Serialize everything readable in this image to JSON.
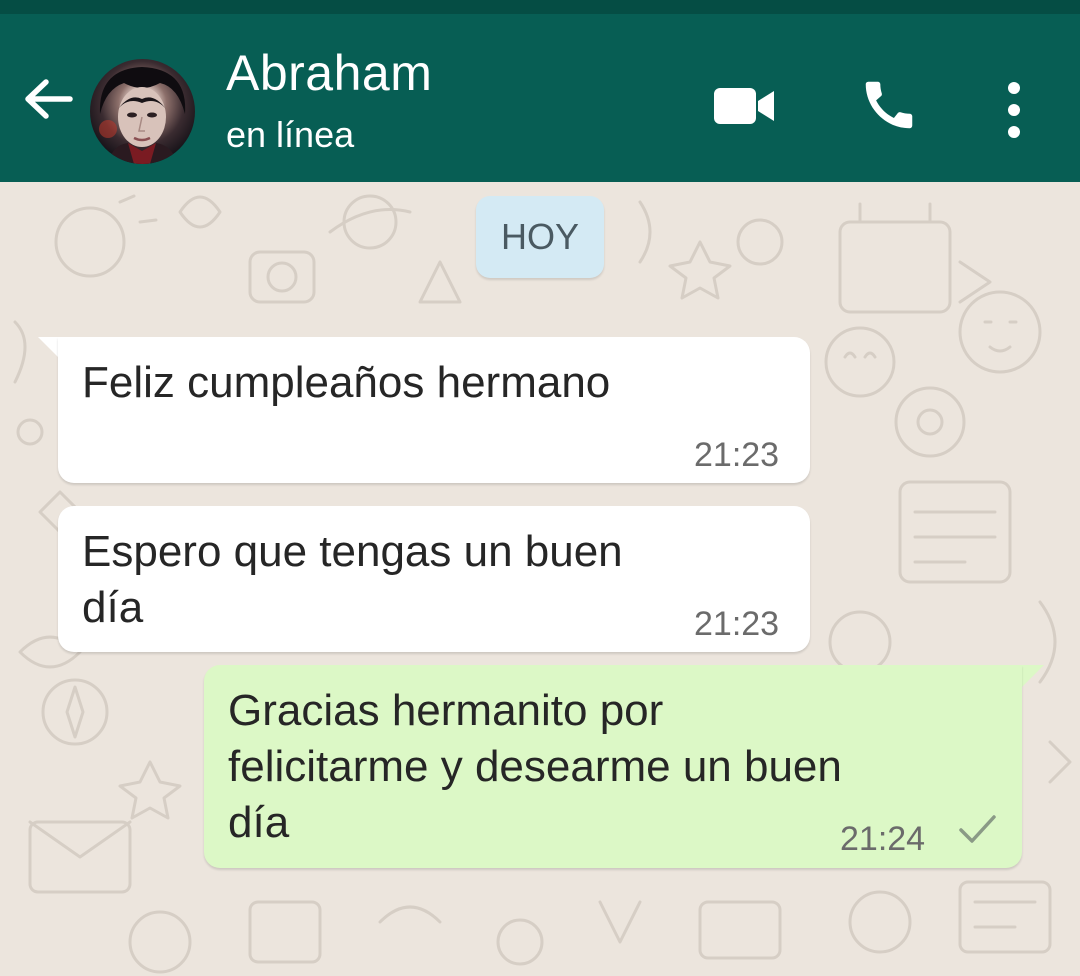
{
  "header": {
    "contact_name": "Abraham",
    "contact_status": "en línea",
    "back_icon": "arrow-left-icon",
    "video_icon": "video-camera-icon",
    "call_icon": "phone-icon",
    "menu_icon": "more-vertical-icon",
    "background_color": "#075e54"
  },
  "chat": {
    "date_label": "HOY",
    "messages": [
      {
        "direction": "incoming",
        "text": "Feliz cumpleaños hermano",
        "time": "21:23"
      },
      {
        "direction": "incoming",
        "text": "Espero que tengas un buen día",
        "time": "21:23"
      },
      {
        "direction": "outgoing",
        "text": "Gracias hermanito por felicitarme y desearme un buen día",
        "time": "21:24",
        "status_icon": "single-check-icon"
      }
    ],
    "incoming_color": "#ffffff",
    "outgoing_color": "#dcf8c6",
    "wallpaper_color": "#ece5dd"
  }
}
